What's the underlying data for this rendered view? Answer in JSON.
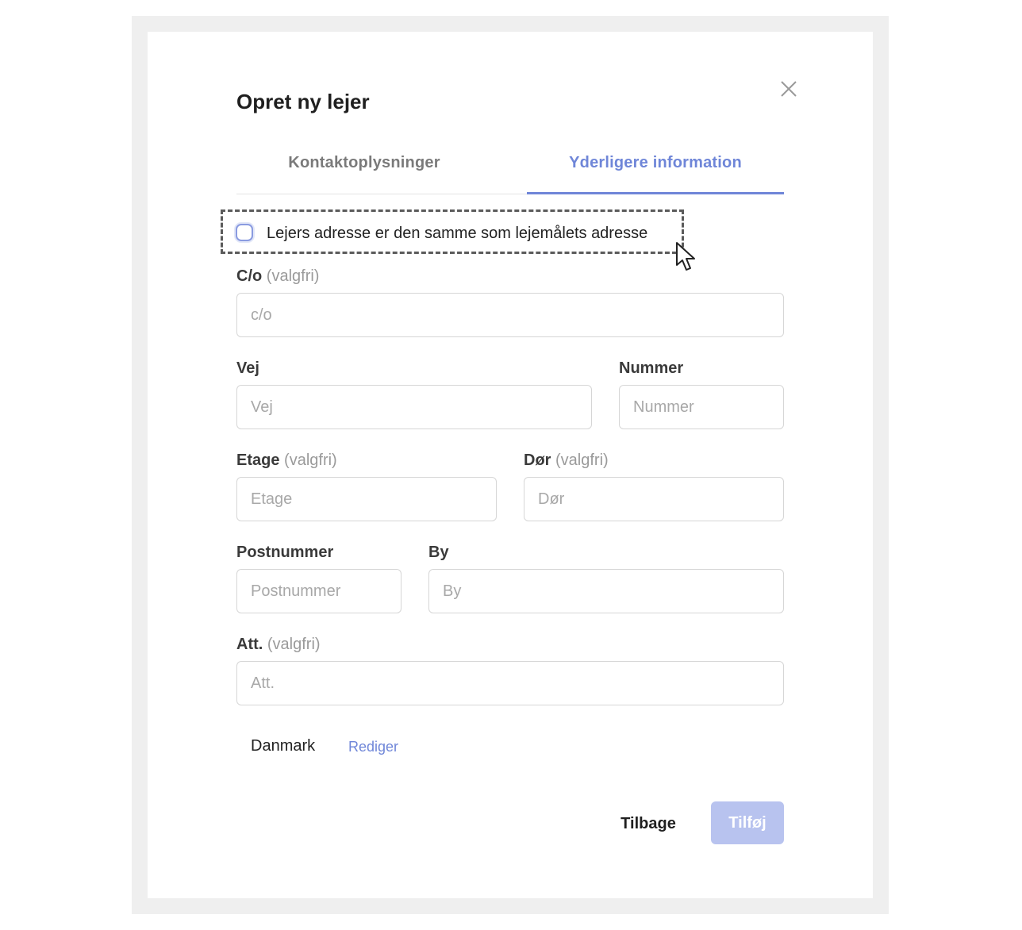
{
  "modal": {
    "title": "Opret ny lejer"
  },
  "icons": {
    "close": "close-icon",
    "cursor": "mouse-pointer-icon"
  },
  "tabs": [
    {
      "label": "Kontaktoplysninger",
      "active": false
    },
    {
      "label": "Yderligere information",
      "active": true
    }
  ],
  "same_address": {
    "label": "Lejers adresse er den samme som lejemålets adresse",
    "checked": false
  },
  "fields": {
    "co": {
      "label": "C/o",
      "optional": "(valgfri)",
      "placeholder": "c/o",
      "value": ""
    },
    "vej": {
      "label": "Vej",
      "placeholder": "Vej",
      "value": ""
    },
    "nummer": {
      "label": "Nummer",
      "placeholder": "Nummer",
      "value": ""
    },
    "etage": {
      "label": "Etage",
      "optional": "(valgfri)",
      "placeholder": "Etage",
      "value": ""
    },
    "dor": {
      "label": "Dør",
      "optional": "(valgfri)",
      "placeholder": "Dør",
      "value": ""
    },
    "postnummer": {
      "label": "Postnummer",
      "placeholder": "Postnummer",
      "value": ""
    },
    "by": {
      "label": "By",
      "placeholder": "By",
      "value": ""
    },
    "att": {
      "label": "Att.",
      "optional": "(valgfri)",
      "placeholder": "Att.",
      "value": ""
    }
  },
  "country": {
    "value": "Danmark",
    "edit_label": "Rediger"
  },
  "actions": {
    "back_label": "Tilbage",
    "add_label": "Tilføj"
  },
  "colors": {
    "accent": "#6f86d8",
    "disabled_button": "#b8c3ef",
    "backdrop": "#efefef"
  }
}
